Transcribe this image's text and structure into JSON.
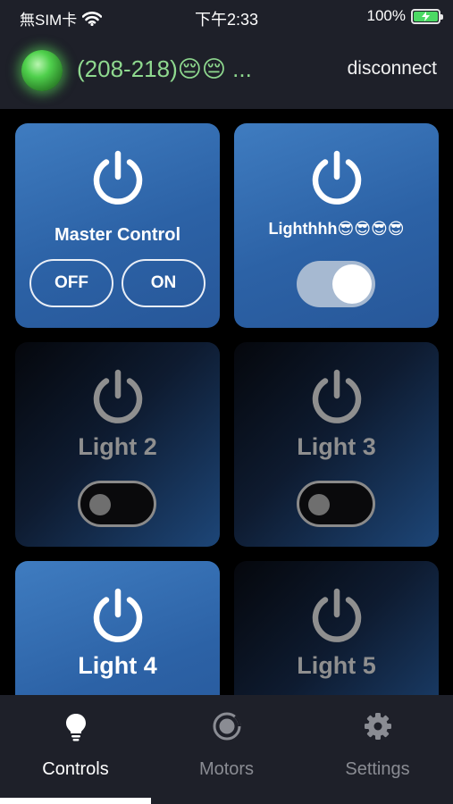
{
  "status_bar": {
    "carrier": "無SIM卡",
    "time": "下午2:33",
    "battery": "100%",
    "battery_level": 1.0,
    "wifi_icon": "wifi-icon",
    "battery_icon": "battery-charging-icon"
  },
  "header": {
    "device_name": "(208-218)😔😔 ...",
    "disconnect_label": "disconnect",
    "led_color": "#4fd04c"
  },
  "cards": {
    "master": {
      "title": "Master Control",
      "off_label": "OFF",
      "on_label": "ON"
    },
    "light1": {
      "title": "Lighthhh😎😎😎😎",
      "state": "on"
    },
    "light2": {
      "title": "Light 2",
      "state": "off"
    },
    "light3": {
      "title": "Light 3",
      "state": "off"
    },
    "light4": {
      "title": "Light 4",
      "state": "on"
    },
    "light5": {
      "title": "Light 5",
      "state": "off"
    }
  },
  "tabs": [
    {
      "label": "Controls",
      "icon": "lightbulb-icon",
      "active": true
    },
    {
      "label": "Motors",
      "icon": "motor-icon",
      "active": false
    },
    {
      "label": "Settings",
      "icon": "gear-icon",
      "active": false
    }
  ],
  "colors": {
    "card_on": "#2f68ad",
    "card_off_dark": "#05070c",
    "tab_active": "#ffffff",
    "tab_inactive": "#8a8c93"
  }
}
